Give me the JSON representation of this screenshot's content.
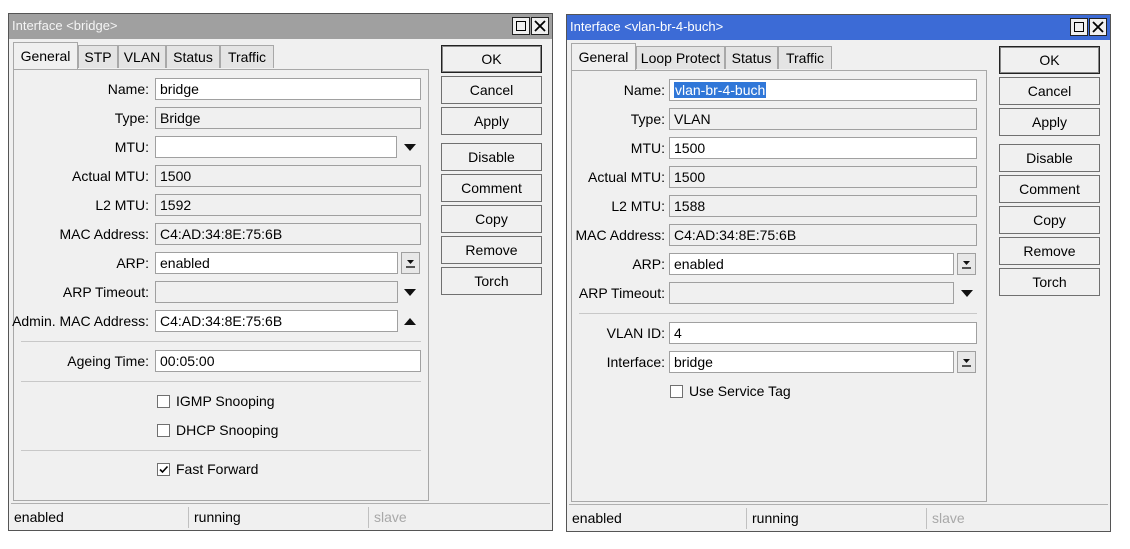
{
  "left_window": {
    "title": "Interface <bridge>",
    "tabs": [
      "General",
      "STP",
      "VLAN",
      "Status",
      "Traffic"
    ],
    "fields": {
      "name_label": "Name:",
      "name_value": "bridge",
      "type_label": "Type:",
      "type_value": "Bridge",
      "mtu_label": "MTU:",
      "mtu_value": "",
      "actual_mtu_label": "Actual MTU:",
      "actual_mtu_value": "1500",
      "l2mtu_label": "L2 MTU:",
      "l2mtu_value": "1592",
      "mac_label": "MAC Address:",
      "mac_value": "C4:AD:34:8E:75:6B",
      "arp_label": "ARP:",
      "arp_value": "enabled",
      "arp_timeout_label": "ARP Timeout:",
      "arp_timeout_value": "",
      "admin_mac_label": "Admin. MAC Address:",
      "admin_mac_value": "C4:AD:34:8E:75:6B",
      "ageing_label": "Ageing Time:",
      "ageing_value": "00:05:00"
    },
    "checkboxes": {
      "igmp": {
        "label": "IGMP Snooping",
        "checked": false
      },
      "dhcp": {
        "label": "DHCP Snooping",
        "checked": false
      },
      "fast_forward": {
        "label": "Fast Forward",
        "checked": true
      }
    },
    "buttons": {
      "ok": "OK",
      "cancel": "Cancel",
      "apply": "Apply",
      "disable": "Disable",
      "comment": "Comment",
      "copy": "Copy",
      "remove": "Remove",
      "torch": "Torch"
    },
    "status": [
      "enabled",
      "running",
      "slave"
    ]
  },
  "right_window": {
    "title": "Interface <vlan-br-4-buch>",
    "tabs": [
      "General",
      "Loop Protect",
      "Status",
      "Traffic"
    ],
    "fields": {
      "name_label": "Name:",
      "name_value": "vlan-br-4-buch",
      "type_label": "Type:",
      "type_value": "VLAN",
      "mtu_label": "MTU:",
      "mtu_value": "1500",
      "actual_mtu_label": "Actual MTU:",
      "actual_mtu_value": "1500",
      "l2mtu_label": "L2 MTU:",
      "l2mtu_value": "1588",
      "mac_label": "MAC Address:",
      "mac_value": "C4:AD:34:8E:75:6B",
      "arp_label": "ARP:",
      "arp_value": "enabled",
      "arp_timeout_label": "ARP Timeout:",
      "arp_timeout_value": "",
      "vlan_id_label": "VLAN ID:",
      "vlan_id_value": "4",
      "interface_label": "Interface:",
      "interface_value": "bridge"
    },
    "checkboxes": {
      "service_tag": {
        "label": "Use Service Tag",
        "checked": false
      }
    },
    "buttons": {
      "ok": "OK",
      "cancel": "Cancel",
      "apply": "Apply",
      "disable": "Disable",
      "comment": "Comment",
      "copy": "Copy",
      "remove": "Remove",
      "torch": "Torch"
    },
    "status": [
      "enabled",
      "running",
      "slave"
    ]
  },
  "colors": {
    "active_title": "#3c6bd6",
    "inactive_title": "#a0a0a0",
    "selection": "#3077d8"
  }
}
